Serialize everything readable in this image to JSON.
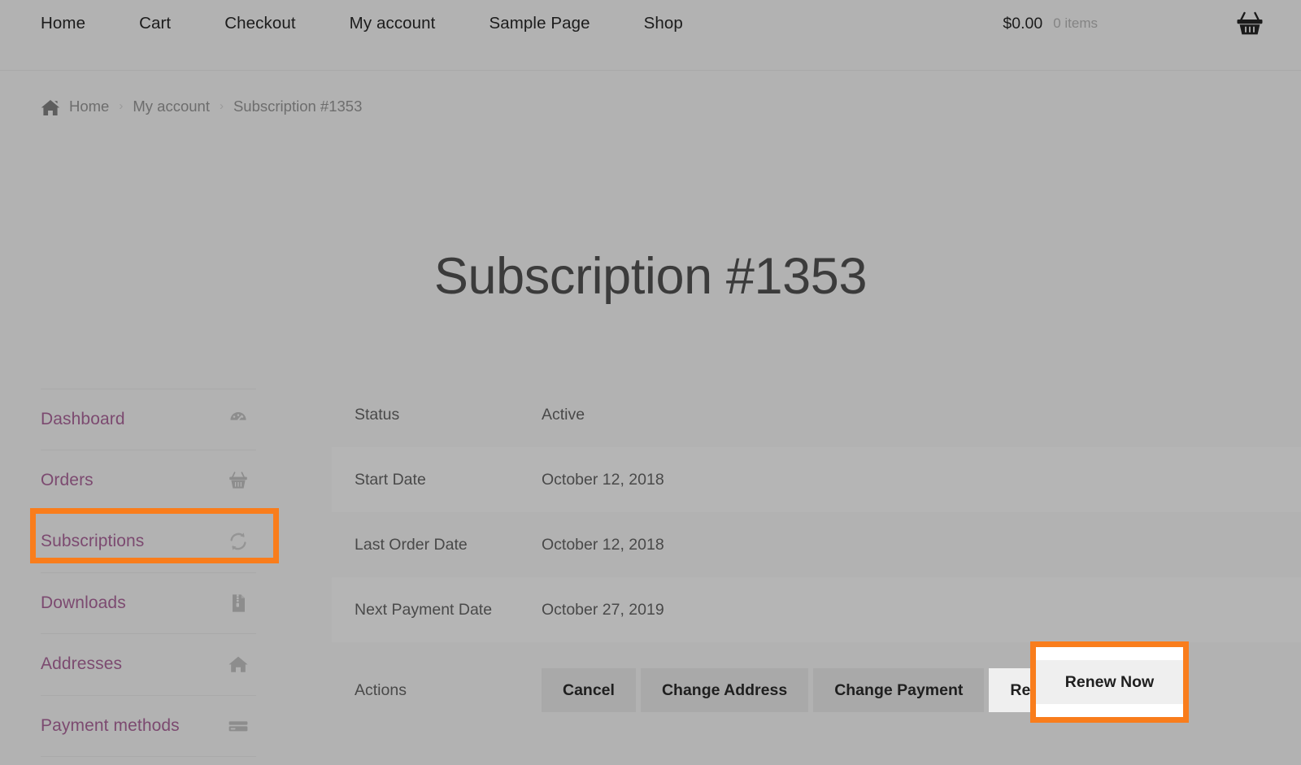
{
  "header": {
    "nav": [
      {
        "label": "Home"
      },
      {
        "label": "Cart"
      },
      {
        "label": "Checkout"
      },
      {
        "label": "My account"
      },
      {
        "label": "Sample Page"
      },
      {
        "label": "Shop"
      }
    ],
    "cart": {
      "total": "$0.00",
      "count": "0 items",
      "icon": "shopping-basket-icon"
    }
  },
  "breadcrumb": {
    "home_icon": "home-icon",
    "items": [
      {
        "label": "Home"
      },
      {
        "label": "My account"
      },
      {
        "label": "Subscription #1353"
      }
    ],
    "separator": "›"
  },
  "page": {
    "title": "Subscription #1353"
  },
  "sidebar": {
    "items": [
      {
        "label": "Dashboard",
        "icon": "dashboard-gauge-icon"
      },
      {
        "label": "Orders",
        "icon": "basket-icon"
      },
      {
        "label": "Subscriptions",
        "icon": "refresh-sync-icon"
      },
      {
        "label": "Downloads",
        "icon": "zip-file-icon"
      },
      {
        "label": "Addresses",
        "icon": "home-icon"
      },
      {
        "label": "Payment methods",
        "icon": "credit-card-icon"
      }
    ]
  },
  "details": {
    "rows": [
      {
        "label": "Status",
        "value": "Active"
      },
      {
        "label": "Start Date",
        "value": "October 12, 2018"
      },
      {
        "label": "Last Order Date",
        "value": "October 12, 2018"
      },
      {
        "label": "Next Payment Date",
        "value": "October 27, 2019"
      }
    ],
    "actions_label": "Actions",
    "buttons": [
      {
        "label": "Cancel"
      },
      {
        "label": "Change Address"
      },
      {
        "label": "Change Payment"
      },
      {
        "label": "Renew Now"
      }
    ]
  },
  "highlights": {
    "color": "#f97d1c",
    "targets": [
      "Subscriptions",
      "Renew Now"
    ]
  },
  "colors": {
    "page_background": "#b2b2b2",
    "link_purple": "#7c4a70",
    "text_dark": "#494949",
    "button_gray": "#a9a9a9",
    "highlight_orange": "#f97d1c"
  }
}
